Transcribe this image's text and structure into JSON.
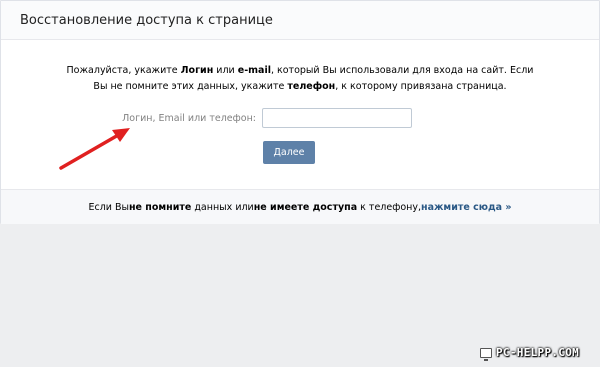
{
  "header": {
    "title": "Восстановление доступа к странице"
  },
  "intro": {
    "line1_a": "Пожалуйста, укажите ",
    "line1_b": "Логин",
    "line1_c": " или ",
    "line1_d": "e-mail",
    "line1_e": ", который Вы использовали для входа на сайт. Если",
    "line2_a": "Вы не помните этих данных, укажите ",
    "line2_b": "телефон",
    "line2_c": ", к которому привязана страница."
  },
  "form": {
    "login_label": "Логин, Email или телефон:",
    "login_value": "",
    "submit_label": "Далее"
  },
  "footer": {
    "part1": "Если Вы ",
    "part2": "не помните",
    "part3": " данных или ",
    "part4": "не имеете доступа",
    "part5": " к телефону, ",
    "link": "нажмите сюда »"
  },
  "watermark": {
    "text": "PC-HELPP.COM"
  },
  "colors": {
    "accent_button": "#5e81a8",
    "link": "#2a5885",
    "arrow": "#e02020",
    "page_bg": "#edeef0"
  }
}
